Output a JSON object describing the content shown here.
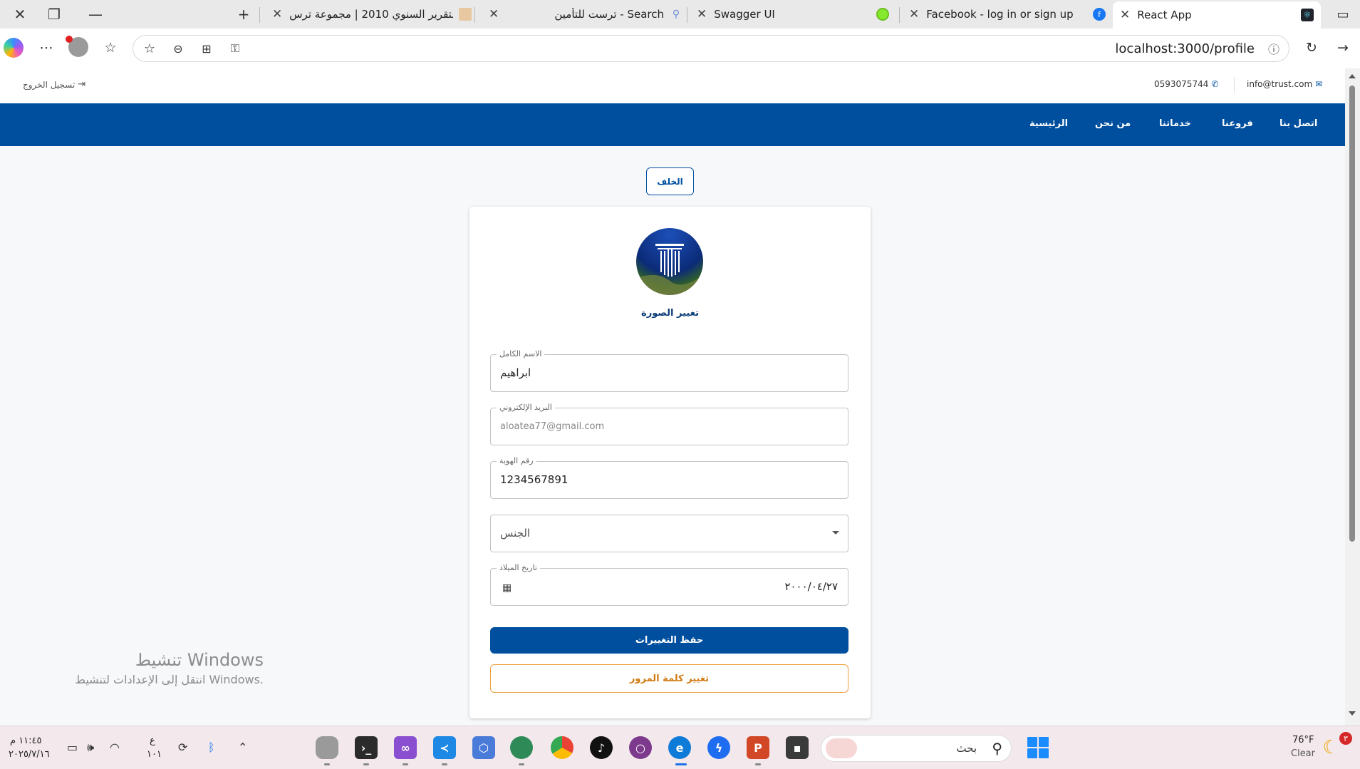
{
  "browser": {
    "tabs": [
      {
        "title": "التقرير السنوي 2010 | مجموعة ترس..."
      },
      {
        "title": "ترست للتأمين - Search"
      },
      {
        "title": "Swagger UI"
      },
      {
        "title": "Facebook - log in or sign up"
      },
      {
        "title": "React App"
      }
    ],
    "url": "localhost:3000/profile"
  },
  "site": {
    "logout_label": "تسجيل الخروج",
    "phone": "0593075744",
    "email": "info@trust.com",
    "nav": [
      "اتصل بنا",
      "فروعنا",
      "خدماتنا",
      "من نحن",
      "الرئيسية"
    ]
  },
  "profile": {
    "back_label": "الخلف",
    "change_photo_label": "تغيير الصورة",
    "fields": {
      "full_name": {
        "label": "الاسم الكامل",
        "value": "ابراهيم"
      },
      "email": {
        "label": "البريد الإلكتروني",
        "value": "aloatea77@gmail.com"
      },
      "id_number": {
        "label": "رقم الهوية",
        "value": "1234567891"
      },
      "gender": {
        "placeholder": "الجنس"
      },
      "birth_date": {
        "label": "تاريخ الميلاد",
        "value": "٢٠٠٠/٠٤/٢٧"
      }
    },
    "save_label": "حفظ التغييرات",
    "change_password_label": "تغيير كلمة المرور"
  },
  "watermark": {
    "title": "تنشيط Windows",
    "subtitle": "انتقل إلى الإعدادات لتنشيط Windows."
  },
  "taskbar": {
    "time": "١١:٤٥ م",
    "date": "٢٠٢٥/٧/١٦",
    "lang_line1": "ع",
    "lang_line2": "١٠١",
    "search_placeholder": "بحث",
    "weather_temp": "76°F",
    "weather_desc": "Clear",
    "notif_count": "٣"
  }
}
